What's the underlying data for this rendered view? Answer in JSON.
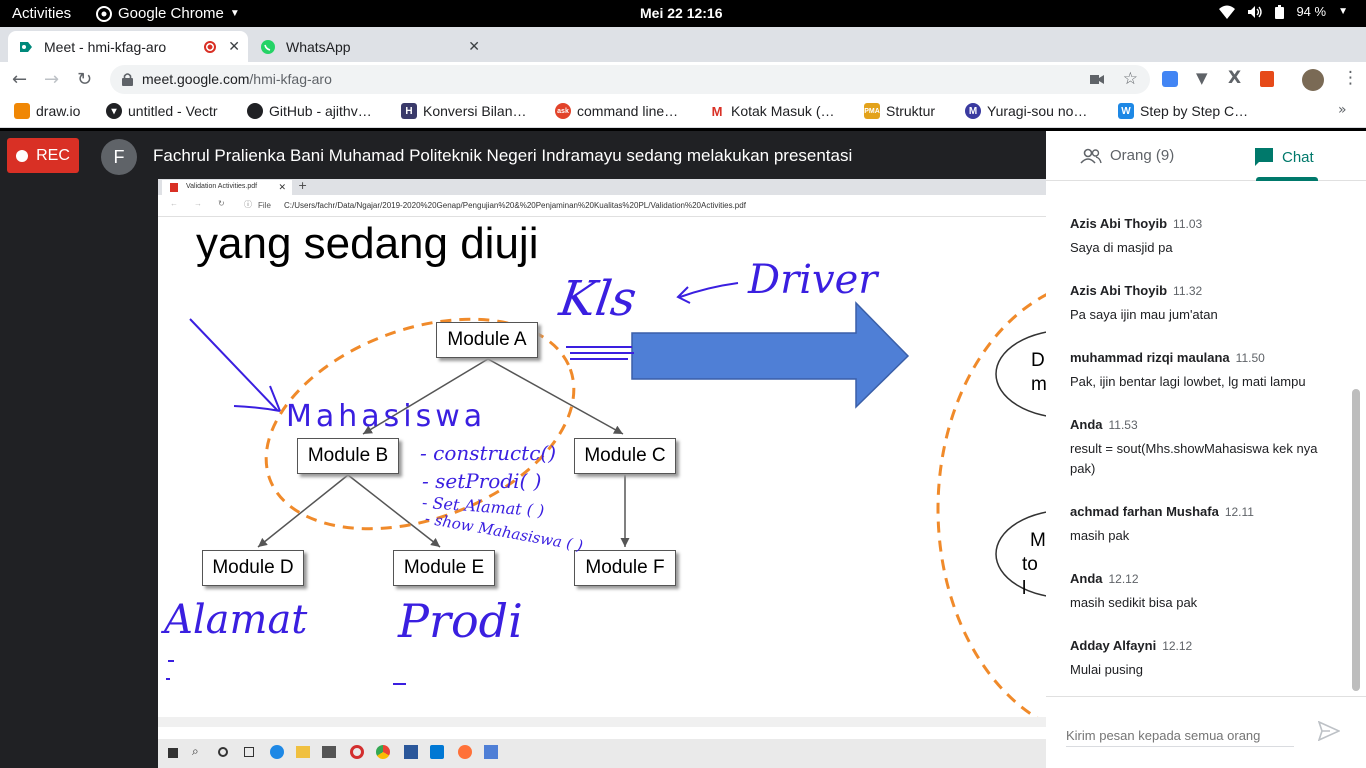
{
  "topbar": {
    "activities": "Activities",
    "app_name": "Google Chrome",
    "clock": "Mei 22  12:16",
    "battery": "94 %"
  },
  "tabs": [
    {
      "title": "Meet - hmi-kfag-aro",
      "active": true
    },
    {
      "title": "WhatsApp",
      "active": false
    }
  ],
  "address": {
    "host": "meet.google.com",
    "path": "/hmi-kfag-aro"
  },
  "bookmarks": [
    {
      "label": "draw.io",
      "icon": "drawio-icon",
      "color": "#f08705"
    },
    {
      "label": "untitled - Vectr",
      "icon": "vectr-icon",
      "color": "#202124"
    },
    {
      "label": "GitHub - ajithv…",
      "icon": "github-icon",
      "color": "#202124"
    },
    {
      "label": "Konversi Bilan…",
      "icon": "konversi-icon",
      "color": "#3a3a6a"
    },
    {
      "label": "command line…",
      "icon": "ask-icon",
      "color": "#e2432a"
    },
    {
      "label": "Kotak Masuk (…",
      "icon": "gmail-icon",
      "color": "#d93025"
    },
    {
      "label": "Struktur",
      "icon": "pma-icon",
      "color": "#e3a21a"
    },
    {
      "label": "Yuragi-sou no…",
      "icon": "yuragi-icon",
      "color": "#3a3aa0"
    },
    {
      "label": "Step by Step C…",
      "icon": "w-icon",
      "color": "#1e88e5"
    }
  ],
  "meet": {
    "rec_label": "REC",
    "presenter_initial": "F",
    "presenter_text": "Fachrul Pralienka Bani Muhamad Politeknik Negeri Indramayu sedang melakukan presentasi"
  },
  "shared_screen": {
    "tab_title": "Validation Activities.pdf",
    "file_label": "File",
    "file_path": "C:/Users/fachr/Data/Ngajar/2019-2020%20Genap/Pengujian%20&%20Penjaminan%20Kualitas%20PL/Validation%20Activities.pdf",
    "slide_title": "yang sedang diuji",
    "modules": [
      "Module A",
      "Module B",
      "Module C",
      "Module D",
      "Module E",
      "Module F"
    ],
    "handwriting": {
      "kls": "Kls",
      "driver": "Driver",
      "mahasiswa": "Mahasiswa",
      "method1": "- constructc()",
      "method2": "- setProdi( )",
      "method3": "- Set Alamat ( )",
      "method4": "- show Mahasiswa ( )",
      "alamat": "Alamat",
      "prodi": "Prodi"
    },
    "partial_right": [
      "D",
      "m",
      "M",
      "to l"
    ]
  },
  "chat": {
    "people_tab": "Orang (9)",
    "chat_tab": "Chat",
    "messages": [
      {
        "sender": "Azis Abi Thoyib",
        "time": "11.03",
        "body": "Saya di masjid pa"
      },
      {
        "sender": "Azis Abi Thoyib",
        "time": "11.32",
        "body": "Pa saya ijin mau jum'atan"
      },
      {
        "sender": "muhammad rizqi maulana",
        "time": "11.50",
        "body": "Pak, ijin bentar lagi lowbet, lg mati lampu"
      },
      {
        "sender": "Anda",
        "time": "11.53",
        "body": "result = sout(Mhs.showMahasiswa kek nya pak)"
      },
      {
        "sender": "achmad farhan Mushafa",
        "time": "12.11",
        "body": "masih pak"
      },
      {
        "sender": "Anda",
        "time": "12.12",
        "body": "masih sedikit bisa pak"
      },
      {
        "sender": "Adday Alfayni",
        "time": "12.12",
        "body": "Mulai pusing"
      }
    ],
    "input_placeholder": "Kirim pesan kepada semua orang"
  },
  "colors": {
    "accent": "#00796b",
    "rec": "#d93025",
    "ink": "#3a1fe0",
    "dashed": "#f08a2a",
    "arrow": "#4f7fd6"
  }
}
